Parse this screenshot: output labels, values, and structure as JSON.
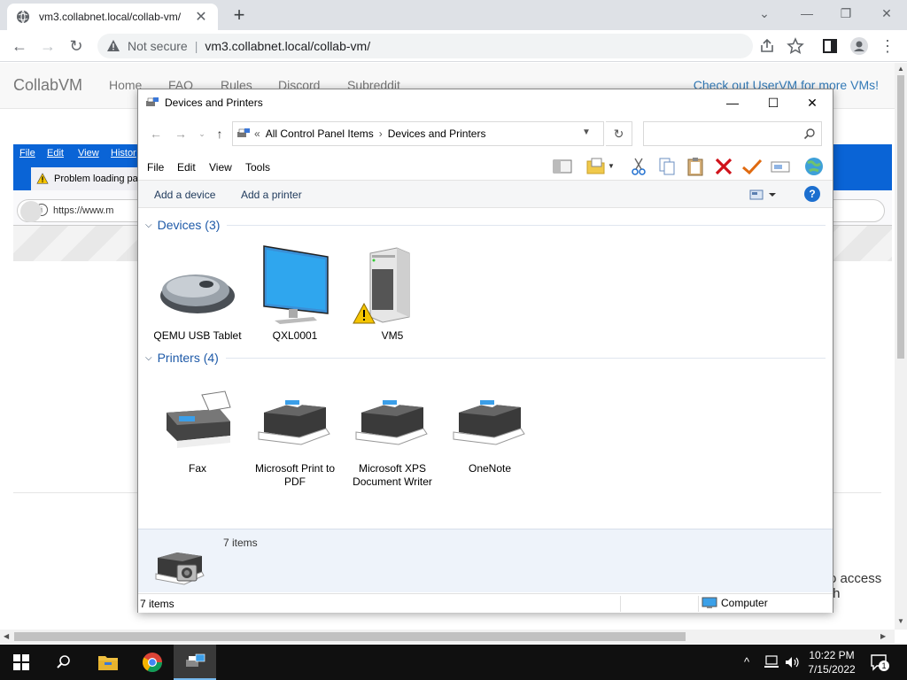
{
  "browser": {
    "tab_title": "vm3.collabnet.local/collab-vm/",
    "tab_close": "✕",
    "new_tab": "+",
    "not_secure": "Not secure",
    "url": "vm3.collabnet.local/collab-vm/"
  },
  "page": {
    "brand": "CollabVM",
    "nav": [
      "Home",
      "FAQ",
      "Rules",
      "Discord",
      "Subreddit"
    ],
    "nav_right": "Check out UserVM for more VMs!",
    "access_text": "o access th"
  },
  "vm_firefox": {
    "menus": [
      "File",
      "Edit",
      "View",
      "Histor"
    ],
    "tab_label": "Problem loading pag",
    "url": "https://www.m"
  },
  "window": {
    "title": "Devices and Printers",
    "minimize": "—",
    "maximize": "☐",
    "close": "✕",
    "breadcrumb_prefix": "«",
    "breadcrumb": [
      "All Control Panel Items",
      "Devices and Printers"
    ],
    "breadcrumb_sep": "›",
    "refresh": "↻",
    "search_placeholder": "",
    "menus": [
      "File",
      "Edit",
      "View",
      "Tools"
    ],
    "commands": [
      "Add a device",
      "Add a printer"
    ],
    "help": "?",
    "groups": [
      {
        "label": "Devices (3)",
        "items": [
          "QEMU USB Tablet",
          "QXL0001",
          "VM5"
        ]
      },
      {
        "label": "Printers (4)",
        "items": [
          "Fax",
          "Microsoft Print to PDF",
          "Microsoft XPS Document Writer",
          "OneNote"
        ]
      }
    ],
    "details_count": "7 items",
    "status_left": "7 items",
    "status_right": "Computer"
  },
  "taskbar": {
    "time": "10:22 PM",
    "date": "7/15/2022",
    "notif_count": "1"
  },
  "colors": {
    "accent": "#1e5aa8",
    "firefox_blue": "#0a64d6",
    "taskbar": "#101010"
  }
}
